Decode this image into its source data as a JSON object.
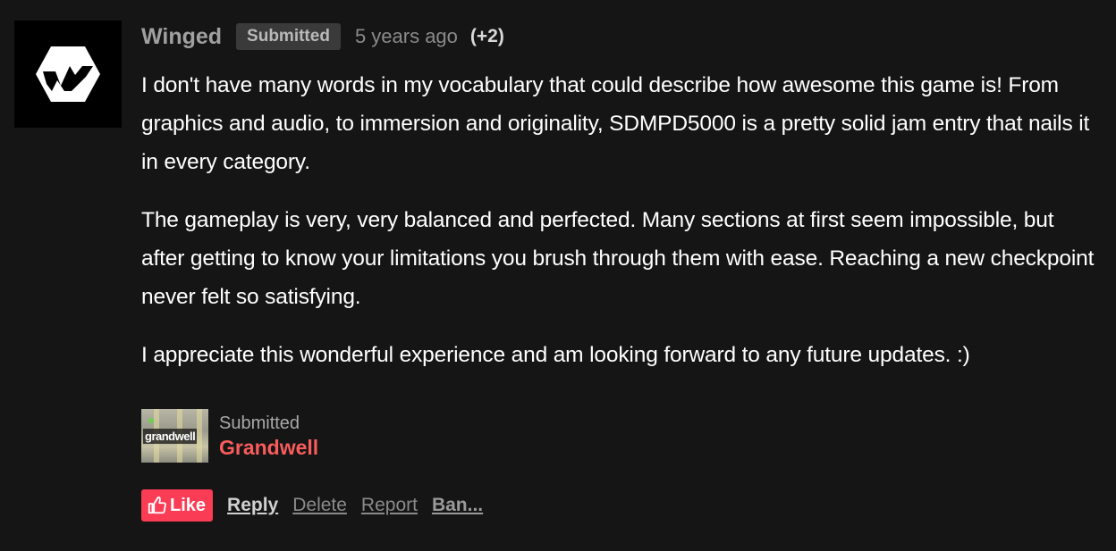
{
  "comment": {
    "author": "Winged",
    "badge": "Submitted",
    "time": "5 years ago",
    "votes": "(+2)",
    "paragraphs": [
      "I don't have many words in my vocabulary that could describe how awesome this game is! From graphics and audio, to immersion and originality,  SDMPD5000 is a pretty solid jam entry that nails it in every category.",
      "The gameplay is very, very balanced and perfected. Many sections at first seem impossible, but after getting to know your limitations you brush through them with ease. Reaching a new checkpoint never felt so satisfying.",
      "I appreciate this wonderful experience and am looking forward to any future updates. :)"
    ]
  },
  "submission": {
    "label": "Submitted",
    "game": "Grandwell",
    "thumb_text": "grandwell"
  },
  "actions": {
    "like": "Like",
    "reply": "Reply",
    "delete": "Delete",
    "report": "Report",
    "ban": "Ban..."
  },
  "icons": {
    "avatar": "winged-hexagon-logo-icon",
    "like": "thumbs-up-icon"
  },
  "colors": {
    "background": "#151515",
    "accent": "#fa5c5c",
    "like_button": "#fa3c54"
  }
}
